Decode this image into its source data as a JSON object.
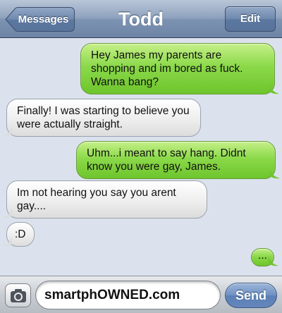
{
  "header": {
    "title": "Todd",
    "back_label": "Messages",
    "edit_label": "Edit"
  },
  "messages": [
    {
      "direction": "outgoing",
      "text": "Hey James my parents are shopping and im bored as fuck. Wanna bang?"
    },
    {
      "direction": "incoming",
      "text": "Finally! I was starting to believe you were actually straight."
    },
    {
      "direction": "outgoing",
      "text": "Uhm...i meant to say hang. Didnt know you were gay, James."
    },
    {
      "direction": "incoming",
      "text": "Im not hearing you say you arent gay...."
    },
    {
      "direction": "incoming",
      "text": ":D"
    },
    {
      "direction": "outgoing",
      "text": "..."
    }
  ],
  "composer": {
    "value": "smartphOWNED.com",
    "send_label": "Send",
    "camera_icon": "camera-icon"
  },
  "colors": {
    "outgoing_bubble": "#7fd03c",
    "incoming_bubble": "#e8e8e8",
    "background": "#dbe2ed",
    "navbar": "#7d93b2",
    "send_button": "#6486bb"
  }
}
